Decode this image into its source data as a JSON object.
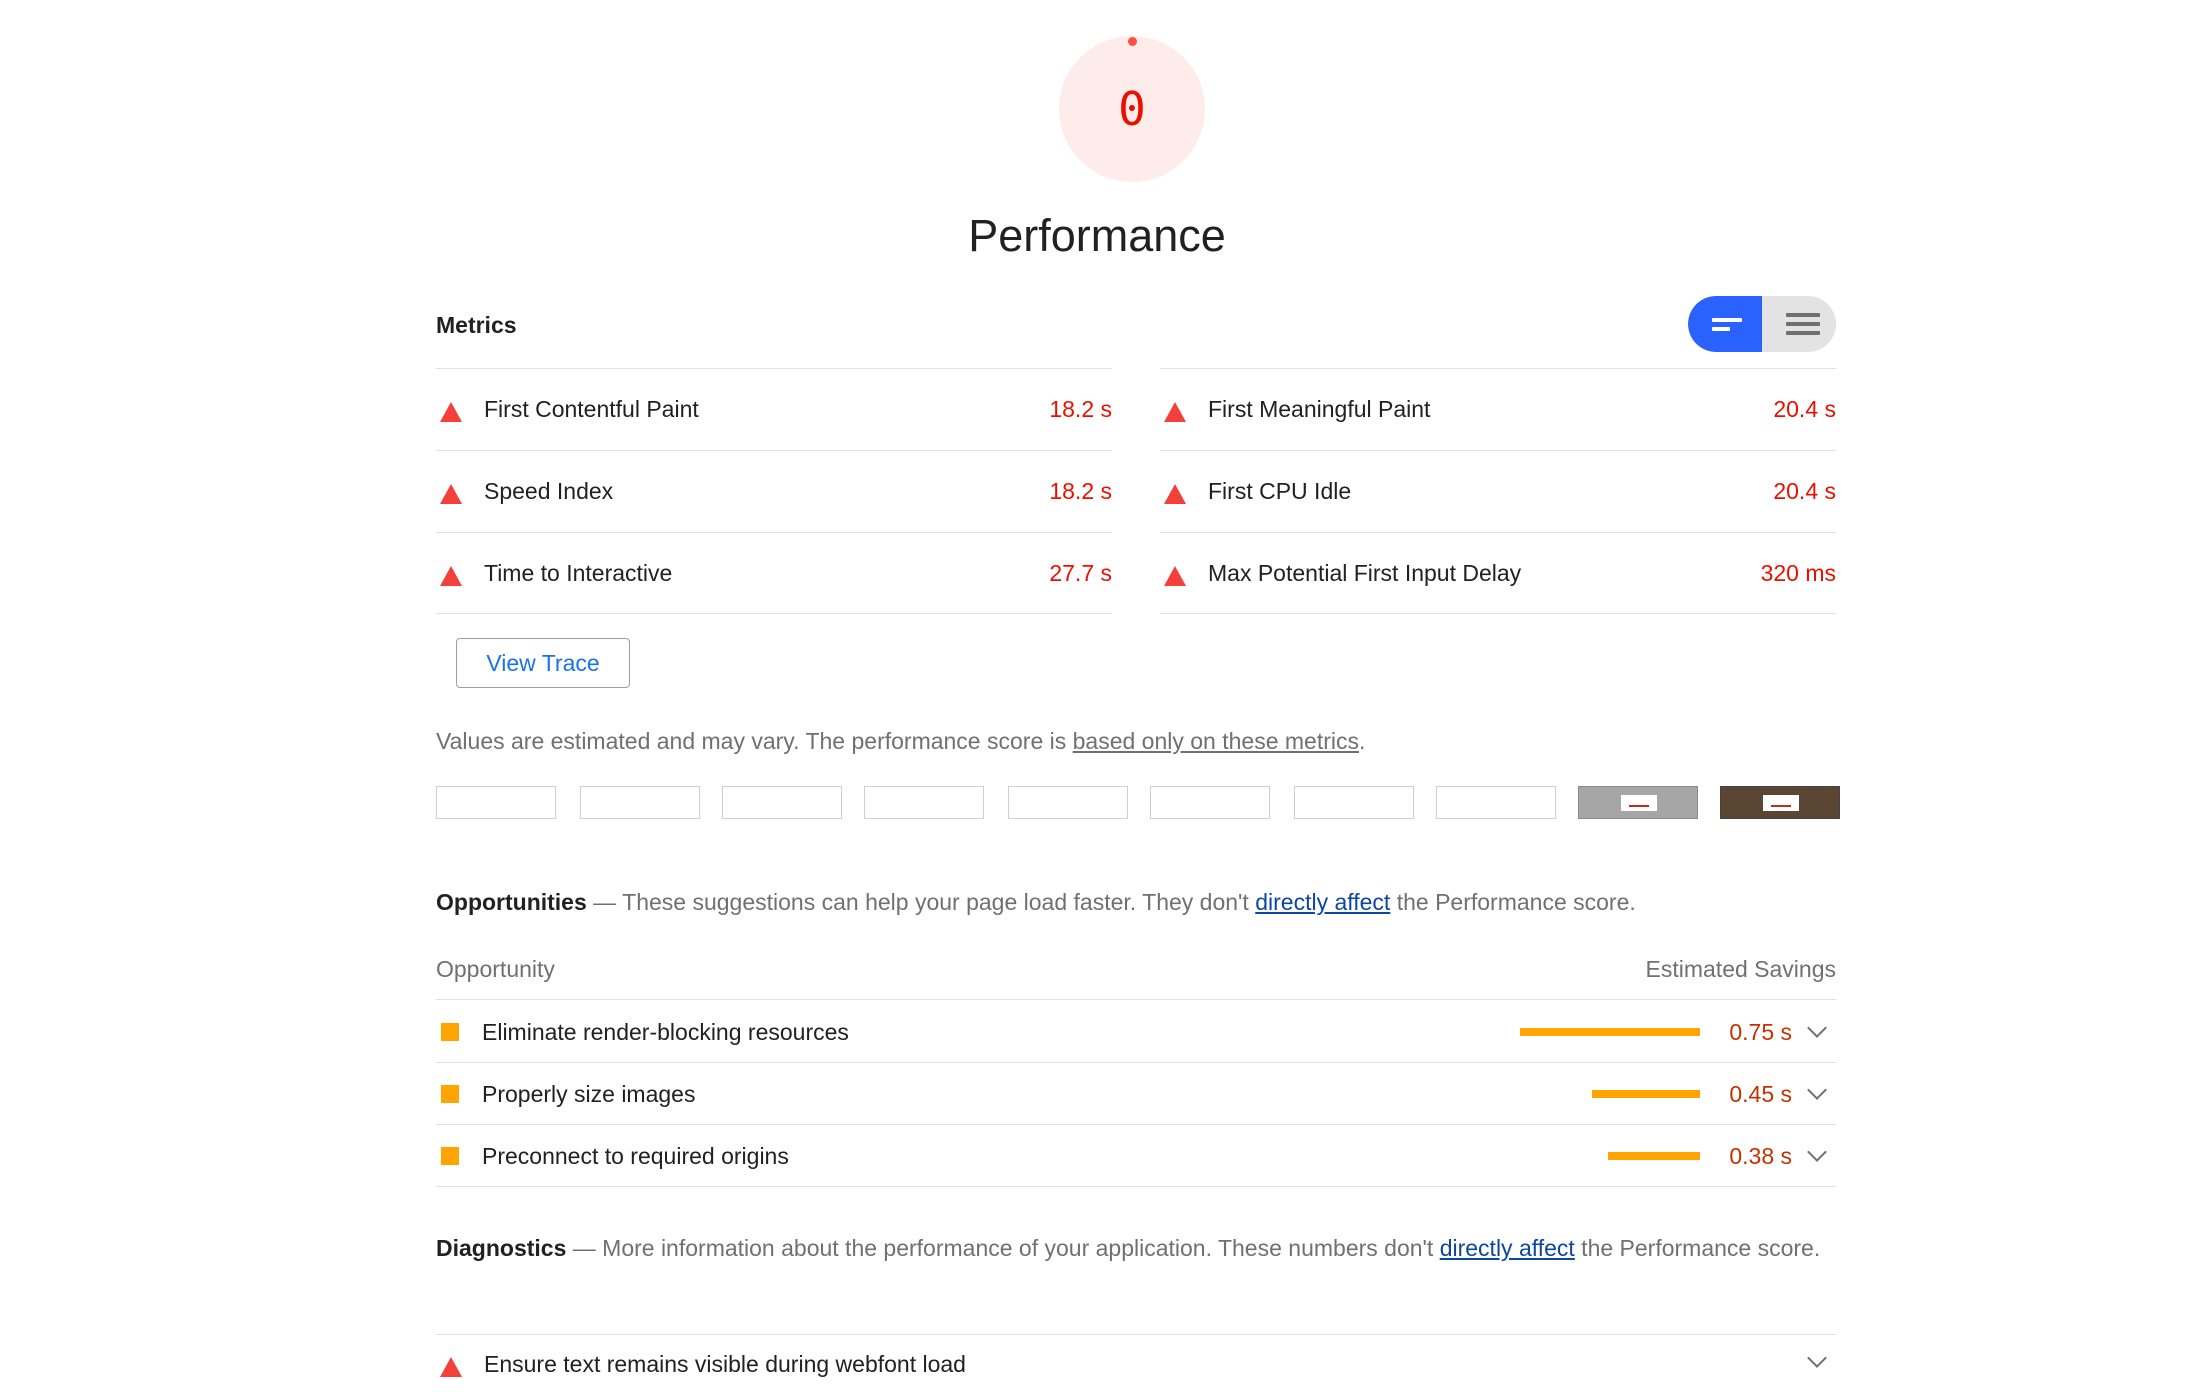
{
  "gauge": {
    "score": "0",
    "title": "Performance"
  },
  "metrics": {
    "title": "Metrics",
    "left": [
      {
        "name": "First Contentful Paint",
        "value": "18.2 s"
      },
      {
        "name": "Speed Index",
        "value": "18.2 s"
      },
      {
        "name": "Time to Interactive",
        "value": "27.7 s"
      }
    ],
    "right": [
      {
        "name": "First Meaningful Paint",
        "value": "20.4 s"
      },
      {
        "name": "First CPU Idle",
        "value": "20.4 s"
      },
      {
        "name": "Max Potential First Input Delay",
        "value": "320 ms"
      }
    ],
    "view_trace": "View Trace",
    "disclaimer_text": "Values are estimated and may vary. The performance score is ",
    "disclaimer_link": "based only on these metrics",
    "disclaimer_end": "."
  },
  "opportunities": {
    "title": "Opportunities",
    "desc_before": "These suggestions can help your page load faster. They don't ",
    "desc_link": "directly affect",
    "desc_after": " the Performance score.",
    "col_left": "Opportunity",
    "col_right": "Estimated Savings",
    "items": [
      {
        "name": "Eliminate render-blocking resources",
        "value": "0.75 s",
        "fraction": 1.0
      },
      {
        "name": "Properly size images",
        "value": "0.45 s",
        "fraction": 0.6
      },
      {
        "name": "Preconnect to required origins",
        "value": "0.38 s",
        "fraction": 0.51
      }
    ]
  },
  "diagnostics": {
    "title": "Diagnostics",
    "desc_before": "More information about the performance of your application. These numbers don't ",
    "desc_link": "directly affect",
    "desc_after": " the Performance score.",
    "items": [
      {
        "name": "Ensure text remains visible during webfont load"
      }
    ]
  },
  "colors": {
    "fail": "#eb0f00",
    "average": "#ffa400",
    "toggle_active": "#2962ff"
  }
}
